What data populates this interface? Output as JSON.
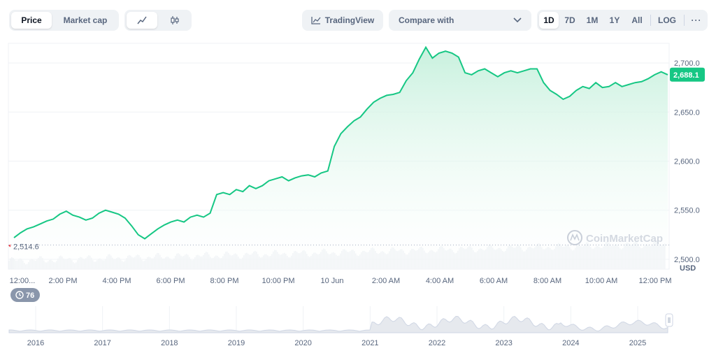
{
  "toolbar": {
    "price_tab": "Price",
    "market_cap_tab": "Market cap",
    "line_icon": "line-chart-icon",
    "candle_icon": "candlestick-icon",
    "tradingview_label": "TradingView",
    "tradingview_icon": "chart-icon",
    "compare_label": "Compare with",
    "compare_icon": "chevron-down-icon",
    "ranges": [
      "1D",
      "7D",
      "1M",
      "1Y",
      "All"
    ],
    "active_range": "1D",
    "log_label": "LOG",
    "more_icon": "ellipsis-icon"
  },
  "colors": {
    "line": "#16c784",
    "fill_top": "#c5f0dc",
    "badge": "#16c784",
    "grid": "#eff2f5",
    "volume": "#eff2f5"
  },
  "chart_data": {
    "type": "area",
    "xlabel": "",
    "ylabel": "USD",
    "x_ticks": [
      "12:00...",
      "2:00 PM",
      "4:00 PM",
      "6:00 PM",
      "8:00 PM",
      "10:00 PM",
      "10 Jun",
      "2:00 AM",
      "4:00 AM",
      "6:00 AM",
      "8:00 AM",
      "10:00 AM",
      "12:00 PM"
    ],
    "y_ticks": [
      "2,700.0",
      "2,650.0",
      "2,600.0",
      "2,550.0",
      "2,500.0"
    ],
    "ylim": [
      2490,
      2720
    ],
    "y_unit": "USD",
    "open_label": "2,514.6",
    "open_value": 2514.6,
    "last_label": "2,688.1",
    "last_value": 2688.1,
    "grid": true,
    "series": [
      {
        "values": [
          2522,
          2527,
          2531,
          2533,
          2536,
          2539,
          2541,
          2546,
          2549,
          2545,
          2543,
          2540,
          2542,
          2547,
          2550,
          2548,
          2546,
          2542,
          2534,
          2525,
          2521,
          2526,
          2531,
          2535,
          2538,
          2540,
          2538,
          2543,
          2545,
          2543,
          2547,
          2566,
          2568,
          2566,
          2571,
          2569,
          2575,
          2572,
          2575,
          2580,
          2582,
          2584,
          2580,
          2583,
          2585,
          2586,
          2584,
          2588,
          2590,
          2615,
          2628,
          2635,
          2641,
          2645,
          2653,
          2660,
          2664,
          2667,
          2668,
          2670,
          2682,
          2690,
          2704,
          2716,
          2705,
          2710,
          2712,
          2710,
          2706,
          2690,
          2688,
          2692,
          2694,
          2690,
          2686,
          2690,
          2692,
          2690,
          2692,
          2694,
          2694,
          2680,
          2672,
          2668,
          2663,
          2666,
          2672,
          2676,
          2674,
          2680,
          2675,
          2676,
          2680,
          2676,
          2678,
          2680,
          2681,
          2684,
          2688,
          2691,
          2688
        ]
      }
    ],
    "navigator_years": [
      "2016",
      "2017",
      "2018",
      "2019",
      "2020",
      "2021",
      "2022",
      "2023",
      "2024",
      "2025"
    ],
    "history_badge": "76",
    "watermark": "CoinMarketCap"
  }
}
